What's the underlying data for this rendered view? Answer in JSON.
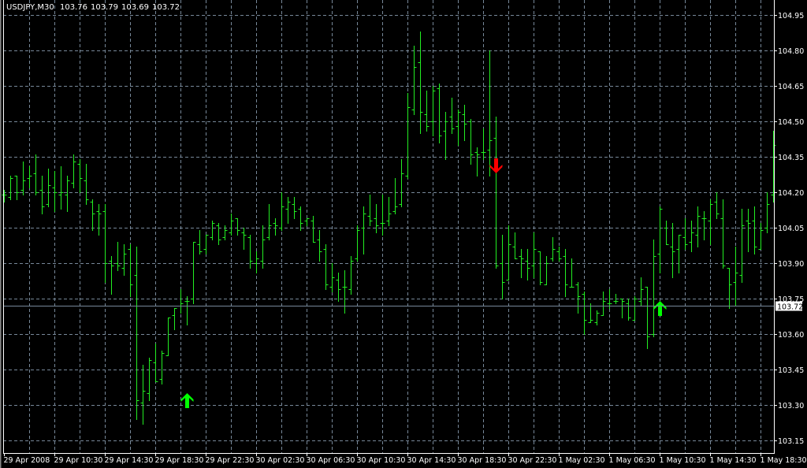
{
  "header": {
    "symbol": "USDJPY,M30",
    "open": "103.76",
    "high": "103.79",
    "low": "103.69",
    "close": "103.72"
  },
  "colors": {
    "background": "#000000",
    "bars": "#22ee22",
    "grid": "#778899",
    "axis": "#ffffff",
    "buy_arrow": "#00ff00",
    "sell_arrow": "#ff0000",
    "price_line": "#778899"
  },
  "chart_data": {
    "type": "ohlc",
    "title": "USDJPY,M30",
    "ylim": [
      103.1,
      104.99
    ],
    "grid": true,
    "price_ticks": [
      "104.95",
      "104.80",
      "104.65",
      "104.50",
      "104.35",
      "104.20",
      "104.05",
      "103.90",
      "103.75",
      "103.60",
      "103.45",
      "103.30",
      "103.15"
    ],
    "time_labels": [
      "29 Apr 2008",
      "29 Apr 10:30",
      "29 Apr 14:30",
      "29 Apr 18:30",
      "29 Apr 22:30",
      "30 Apr 02:30",
      "30 Apr 06:30",
      "30 Apr 10:30",
      "30 Apr 14:30",
      "30 Apr 18:30",
      "30 Apr 22:30",
      "1 May 02:30",
      "1 May 06:30",
      "1 May 10:30",
      "1 May 14:30",
      "1 May 18:30"
    ],
    "time_label_every_bars": 8,
    "current_price": "103.72",
    "bars_ohlc": [
      [
        104.19,
        104.21,
        104.16,
        104.19
      ],
      [
        104.18,
        104.27,
        104.17,
        104.26
      ],
      [
        104.27,
        104.27,
        104.17,
        104.2
      ],
      [
        104.21,
        104.33,
        104.19,
        104.25
      ],
      [
        104.26,
        104.31,
        104.22,
        104.27
      ],
      [
        104.28,
        104.36,
        104.19,
        104.2
      ],
      [
        104.21,
        104.27,
        104.11,
        104.14
      ],
      [
        104.15,
        104.3,
        104.14,
        104.23
      ],
      [
        104.22,
        104.29,
        104.12,
        104.2
      ],
      [
        104.19,
        104.31,
        104.13,
        104.2
      ],
      [
        104.19,
        104.27,
        104.12,
        104.25
      ],
      [
        104.24,
        104.36,
        104.22,
        104.33
      ],
      [
        104.32,
        104.34,
        104.2,
        104.26
      ],
      [
        104.25,
        104.32,
        104.15,
        104.17
      ],
      [
        104.16,
        104.17,
        104.04,
        104.11
      ],
      [
        104.12,
        104.15,
        104.02,
        104.11
      ],
      [
        104.12,
        104.15,
        103.82,
        103.9
      ],
      [
        103.91,
        103.93,
        103.77,
        103.89
      ],
      [
        103.9,
        103.99,
        103.87,
        103.89
      ],
      [
        103.88,
        103.98,
        103.85,
        103.94
      ],
      [
        103.96,
        103.98,
        103.76,
        103.81
      ],
      [
        103.85,
        103.97,
        103.24,
        103.32
      ],
      [
        103.31,
        103.47,
        103.22,
        103.36
      ],
      [
        103.35,
        103.5,
        103.32,
        103.49
      ],
      [
        103.48,
        103.56,
        103.4,
        103.4
      ],
      [
        103.41,
        103.53,
        103.39,
        103.52
      ],
      [
        103.51,
        103.67,
        103.51,
        103.67
      ],
      [
        103.68,
        103.71,
        103.62,
        103.71
      ],
      [
        103.72,
        103.79,
        103.69,
        103.73
      ],
      [
        103.74,
        103.76,
        103.64,
        103.74
      ],
      [
        103.75,
        103.99,
        103.73,
        103.99
      ],
      [
        103.98,
        104.04,
        103.94,
        103.95
      ],
      [
        103.96,
        104.02,
        103.94,
        104.02
      ],
      [
        104.01,
        104.08,
        104.0,
        104.07
      ],
      [
        104.06,
        104.07,
        103.98,
        104.0
      ],
      [
        104.01,
        104.06,
        104.0,
        104.04
      ],
      [
        104.03,
        104.11,
        104.02,
        104.08
      ],
      [
        104.09,
        104.09,
        104.02,
        104.04
      ],
      [
        104.03,
        104.05,
        103.96,
        104.02
      ],
      [
        104.01,
        104.02,
        103.88,
        103.91
      ],
      [
        103.9,
        103.95,
        103.86,
        103.92
      ],
      [
        103.91,
        104.06,
        103.88,
        104.0
      ],
      [
        104.01,
        104.15,
        104.0,
        104.06
      ],
      [
        104.07,
        104.09,
        104.02,
        104.06
      ],
      [
        104.05,
        104.2,
        104.04,
        104.14
      ],
      [
        104.13,
        104.18,
        104.07,
        104.16
      ],
      [
        104.15,
        104.18,
        104.09,
        104.12
      ],
      [
        104.13,
        104.14,
        104.04,
        104.07
      ],
      [
        104.08,
        104.09,
        104.06,
        104.09
      ],
      [
        104.08,
        104.1,
        103.99,
        103.99
      ],
      [
        104.0,
        104.04,
        103.91,
        103.95
      ],
      [
        103.96,
        103.98,
        103.79,
        103.81
      ],
      [
        103.8,
        103.9,
        103.78,
        103.84
      ],
      [
        103.83,
        103.86,
        103.74,
        103.79
      ],
      [
        103.8,
        103.87,
        103.69,
        103.8
      ],
      [
        103.79,
        103.93,
        103.77,
        103.91
      ],
      [
        103.92,
        104.06,
        103.91,
        104.04
      ],
      [
        104.05,
        104.14,
        103.94,
        104.11
      ],
      [
        104.1,
        104.19,
        104.06,
        104.08
      ],
      [
        104.09,
        104.15,
        104.03,
        104.06
      ],
      [
        104.07,
        104.19,
        104.02,
        104.07
      ],
      [
        104.08,
        104.18,
        104.06,
        104.11
      ],
      [
        104.12,
        104.26,
        104.11,
        104.14
      ],
      [
        104.15,
        104.34,
        104.14,
        104.28
      ],
      [
        104.27,
        104.62,
        104.26,
        104.56
      ],
      [
        104.55,
        104.82,
        104.53,
        104.73
      ],
      [
        104.75,
        104.88,
        104.45,
        104.54
      ],
      [
        104.53,
        104.63,
        104.46,
        104.48
      ],
      [
        104.5,
        104.65,
        104.44,
        104.63
      ],
      [
        104.64,
        104.66,
        104.41,
        104.44
      ],
      [
        104.46,
        104.54,
        104.34,
        104.5
      ],
      [
        104.52,
        104.6,
        104.45,
        104.47
      ],
      [
        104.48,
        104.55,
        104.4,
        104.54
      ],
      [
        104.53,
        104.57,
        104.42,
        104.49
      ],
      [
        104.5,
        104.51,
        104.32,
        104.36
      ],
      [
        104.37,
        104.39,
        104.27,
        104.36
      ],
      [
        104.37,
        104.47,
        104.34,
        104.37
      ],
      [
        104.38,
        104.8,
        104.27,
        104.42
      ],
      [
        104.43,
        104.52,
        103.88,
        103.89
      ],
      [
        103.9,
        104.02,
        103.75,
        103.82
      ],
      [
        103.83,
        104.06,
        103.83,
        103.98
      ],
      [
        103.97,
        104.03,
        103.92,
        103.92
      ],
      [
        103.93,
        103.96,
        103.84,
        103.92
      ],
      [
        103.91,
        103.96,
        103.83,
        103.88
      ],
      [
        103.89,
        104.03,
        103.84,
        103.96
      ],
      [
        103.95,
        103.95,
        103.81,
        103.82
      ],
      [
        103.81,
        103.93,
        103.81,
        103.9
      ],
      [
        103.92,
        104.01,
        103.91,
        103.96
      ],
      [
        103.95,
        103.97,
        103.91,
        103.92
      ],
      [
        103.93,
        103.96,
        103.76,
        103.81
      ],
      [
        103.8,
        103.92,
        103.8,
        103.8
      ],
      [
        103.81,
        103.82,
        103.69,
        103.76
      ],
      [
        103.77,
        103.78,
        103.6,
        103.66
      ],
      [
        103.65,
        103.73,
        103.65,
        103.66
      ],
      [
        103.65,
        103.7,
        103.64,
        103.69
      ],
      [
        103.68,
        103.78,
        103.68,
        103.74
      ],
      [
        103.73,
        103.79,
        103.71,
        103.73
      ],
      [
        103.74,
        103.77,
        103.73,
        103.74
      ],
      [
        103.75,
        103.75,
        103.67,
        103.74
      ],
      [
        103.73,
        103.75,
        103.66,
        103.67
      ],
      [
        103.66,
        103.76,
        103.66,
        103.75
      ],
      [
        103.74,
        103.84,
        103.72,
        103.79
      ],
      [
        103.8,
        103.8,
        103.54,
        103.59
      ],
      [
        103.6,
        104.0,
        103.59,
        103.93
      ],
      [
        103.94,
        104.14,
        103.86,
        104.13
      ],
      [
        104.05,
        104.08,
        103.98,
        103.98
      ],
      [
        103.97,
        104.07,
        103.84,
        103.95
      ],
      [
        103.96,
        104.02,
        103.86,
        104.02
      ],
      [
        104.01,
        104.09,
        103.96,
        103.98
      ],
      [
        103.99,
        104.08,
        103.95,
        104.03
      ],
      [
        104.02,
        104.14,
        103.97,
        104.1
      ],
      [
        104.09,
        104.12,
        104.0,
        104.09
      ],
      [
        104.08,
        104.17,
        103.98,
        104.15
      ],
      [
        104.16,
        104.2,
        104.09,
        104.11
      ],
      [
        104.09,
        104.17,
        103.88,
        103.89
      ],
      [
        103.88,
        103.88,
        103.71,
        103.81
      ],
      [
        103.82,
        103.97,
        103.72,
        103.86
      ],
      [
        103.85,
        104.13,
        103.82,
        104.06
      ],
      [
        104.08,
        104.13,
        103.95,
        104.07
      ],
      [
        104.08,
        104.14,
        103.94,
        103.97
      ],
      [
        103.96,
        104.07,
        103.96,
        104.04
      ],
      [
        104.05,
        104.2,
        104.03,
        104.15
      ],
      [
        104.19,
        104.46,
        104.16,
        104.4
      ]
    ],
    "signals": [
      {
        "bar": 29,
        "type": "buy",
        "price": 103.35
      },
      {
        "bar": 78,
        "type": "sell",
        "price": 104.28
      },
      {
        "bar": 104,
        "type": "buy",
        "price": 103.74
      }
    ]
  }
}
